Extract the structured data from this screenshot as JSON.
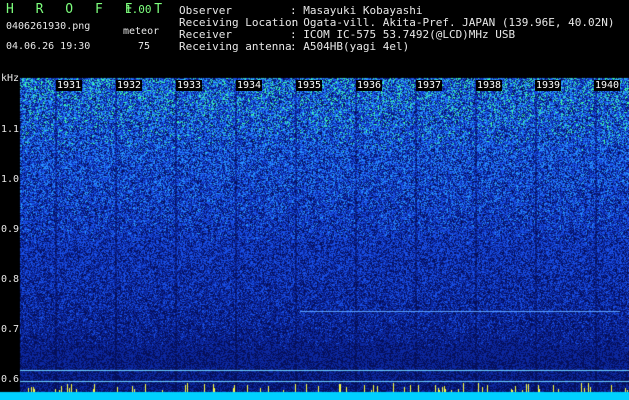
{
  "header": {
    "app_title": "H R O F F T",
    "version": "1.00",
    "filename": "0406261930.png",
    "meteor_label": "meteor",
    "datetime": "04.06.26 19:30",
    "meteor_count": "75",
    "fields": [
      {
        "key": "Observer",
        "value": ": Masayuki Kobayashi"
      },
      {
        "key": "Receiving Location",
        "value": ": Ogata-vill. Akita-Pref. JAPAN (139.96E, 40.02N)"
      },
      {
        "key": "Receiver",
        "value": ": ICOM IC-575 53.7492(@LCD)MHz USB"
      },
      {
        "key": "Receiving antenna",
        "value": ": A504HB(yagi 4el)"
      }
    ]
  },
  "spectrogram": {
    "y_unit": "kHz",
    "y_ticks": [
      "1.1",
      "1.0",
      "0.9",
      "0.8",
      "0.7",
      "0.6"
    ],
    "time_labels": [
      "1931",
      "1932",
      "1933",
      "1934",
      "1935",
      "1936",
      "1937",
      "1938",
      "1939",
      "1940"
    ],
    "colors": {
      "low": "#0a1f8c",
      "mid": "#1e5cff",
      "high": "#3fffb0",
      "band": "#00d0ff",
      "meteor": "#ffff40"
    }
  }
}
